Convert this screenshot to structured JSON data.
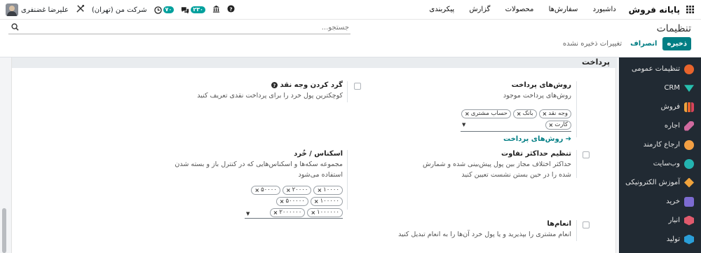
{
  "topbar": {
    "brand": "پایانه فروش",
    "menu": [
      "داشبورد",
      "سفارش‌ها",
      "محصولات",
      "گزارش",
      "پیکربندی"
    ],
    "user_name": "علیرضا غضنفری",
    "company": "شرکت من (تهران)",
    "activity_count": "۷۰",
    "messages_count": "۲۳۰"
  },
  "control": {
    "title": "تنظیمات",
    "search_placeholder": "جستجو...",
    "save_label": "ذخیره",
    "discard_label": "انصراف",
    "unsaved_label": "تغییرات ذخیره نشده"
  },
  "sidebar": {
    "items": [
      {
        "label": "تنظیمات عمومی",
        "icon": "general-settings-icon",
        "color": "#e8642c"
      },
      {
        "label": "CRM",
        "icon": "crm-icon",
        "color": "#27bfae"
      },
      {
        "label": "فروش",
        "icon": "sales-icon",
        "color": "#f0a33c"
      },
      {
        "label": "اجاره",
        "icon": "rental-icon",
        "color": "#d06a9f"
      },
      {
        "label": "ارجاع کارمند",
        "icon": "referral-icon",
        "color": "#f29f43"
      },
      {
        "label": "وب‌سایت",
        "icon": "website-icon",
        "color": "#23b3b0"
      },
      {
        "label": "آموزش الکترونیکی",
        "icon": "elearning-icon",
        "color": "#f0a33c"
      },
      {
        "label": "خرید",
        "icon": "purchase-icon",
        "color": "#7c6bd1"
      },
      {
        "label": "انبار",
        "icon": "inventory-icon",
        "color": "#e05a6d"
      },
      {
        "label": "تولید",
        "icon": "manufacturing-icon",
        "color": "#2a9ed8"
      }
    ]
  },
  "section": {
    "title": "پرداخت",
    "payment_methods": {
      "title": "روش‌های پرداخت",
      "desc": "روش‌های پرداخت موجود",
      "tags": [
        "وجه نقد",
        "بانک",
        "حساب مشتری",
        "کارت"
      ],
      "link": "روش‌های پرداخت"
    },
    "cash_rounding": {
      "title": "گرد کردن وجه نقد",
      "desc": "کوچکترین پول خرد را برای پرداخت نقدی تعریف کنید"
    },
    "max_difference": {
      "title": "تنظیم حداکثر تفاوت",
      "desc": "حداکثر اختلاف مجاز بین پول پیش‌بینی شده و شمارش شده را در حین بستن نشست تعیین کنید"
    },
    "coins_bills": {
      "title": "اسکناس / خُرد",
      "desc": "مجموعه سکه‌ها و اسکناس‌هایی که در کنترل باز و بسته شدن استفاده می‌شود",
      "tags": [
        "۱۰۰۰۰",
        "۲۰۰۰۰",
        "۵۰۰۰۰",
        "۱۰۰۰۰۰",
        "۵۰۰۰۰۰",
        "۱۰۰۰۰۰۰",
        "۲۰۰۰۰۰۰"
      ]
    },
    "tips": {
      "title": "انعام‌ها",
      "desc": "انعام مشتری را بپذیرید و یا پول خرد آن‌ها را به انعام تبدیل کنید"
    }
  }
}
